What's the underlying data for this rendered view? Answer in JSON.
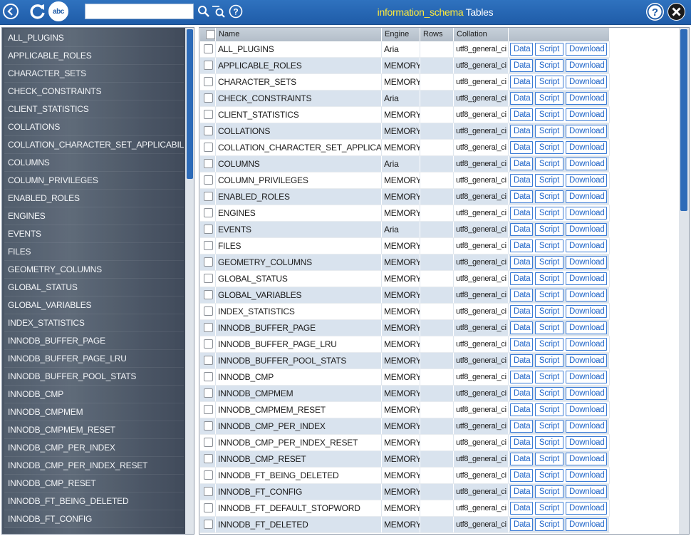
{
  "toolbar": {
    "back_icon": "chevron-left-icon",
    "refresh_icon": "refresh-icon",
    "abc_label": "abc",
    "search_placeholder": "",
    "search_value": ""
  },
  "title": {
    "database": "information_schema",
    "suffix": " Tables"
  },
  "colors": {
    "topbar": "#2a67b4",
    "title_highlight": "#ffeb3b",
    "row_alt": "#d9e3ee",
    "button_text": "#1e64c8"
  },
  "sidebar": {
    "items": [
      "ALL_PLUGINS",
      "APPLICABLE_ROLES",
      "CHARACTER_SETS",
      "CHECK_CONSTRAINTS",
      "CLIENT_STATISTICS",
      "COLLATIONS",
      "COLLATION_CHARACTER_SET_APPLICABILITY",
      "COLUMNS",
      "COLUMN_PRIVILEGES",
      "ENABLED_ROLES",
      "ENGINES",
      "EVENTS",
      "FILES",
      "GEOMETRY_COLUMNS",
      "GLOBAL_STATUS",
      "GLOBAL_VARIABLES",
      "INDEX_STATISTICS",
      "INNODB_BUFFER_PAGE",
      "INNODB_BUFFER_PAGE_LRU",
      "INNODB_BUFFER_POOL_STATS",
      "INNODB_CMP",
      "INNODB_CMPMEM",
      "INNODB_CMPMEM_RESET",
      "INNODB_CMP_PER_INDEX",
      "INNODB_CMP_PER_INDEX_RESET",
      "INNODB_CMP_RESET",
      "INNODB_FT_BEING_DELETED",
      "INNODB_FT_CONFIG"
    ]
  },
  "table": {
    "headers": {
      "name": "Name",
      "engine": "Engine",
      "rows": "Rows",
      "collation": "Collation"
    },
    "buttons": {
      "data": "Data",
      "script": "Script",
      "download": "Download"
    },
    "rows": [
      {
        "name": "ALL_PLUGINS",
        "engine": "Aria",
        "rows": "",
        "collation": "utf8_general_ci"
      },
      {
        "name": "APPLICABLE_ROLES",
        "engine": "MEMORY",
        "rows": "",
        "collation": "utf8_general_ci"
      },
      {
        "name": "CHARACTER_SETS",
        "engine": "MEMORY",
        "rows": "",
        "collation": "utf8_general_ci"
      },
      {
        "name": "CHECK_CONSTRAINTS",
        "engine": "Aria",
        "rows": "",
        "collation": "utf8_general_ci"
      },
      {
        "name": "CLIENT_STATISTICS",
        "engine": "MEMORY",
        "rows": "",
        "collation": "utf8_general_ci"
      },
      {
        "name": "COLLATIONS",
        "engine": "MEMORY",
        "rows": "",
        "collation": "utf8_general_ci"
      },
      {
        "name": "COLLATION_CHARACTER_SET_APPLICABILITY",
        "engine": "MEMORY",
        "rows": "",
        "collation": "utf8_general_ci"
      },
      {
        "name": "COLUMNS",
        "engine": "Aria",
        "rows": "",
        "collation": "utf8_general_ci"
      },
      {
        "name": "COLUMN_PRIVILEGES",
        "engine": "MEMORY",
        "rows": "",
        "collation": "utf8_general_ci"
      },
      {
        "name": "ENABLED_ROLES",
        "engine": "MEMORY",
        "rows": "",
        "collation": "utf8_general_ci"
      },
      {
        "name": "ENGINES",
        "engine": "MEMORY",
        "rows": "",
        "collation": "utf8_general_ci"
      },
      {
        "name": "EVENTS",
        "engine": "Aria",
        "rows": "",
        "collation": "utf8_general_ci"
      },
      {
        "name": "FILES",
        "engine": "MEMORY",
        "rows": "",
        "collation": "utf8_general_ci"
      },
      {
        "name": "GEOMETRY_COLUMNS",
        "engine": "MEMORY",
        "rows": "",
        "collation": "utf8_general_ci"
      },
      {
        "name": "GLOBAL_STATUS",
        "engine": "MEMORY",
        "rows": "",
        "collation": "utf8_general_ci"
      },
      {
        "name": "GLOBAL_VARIABLES",
        "engine": "MEMORY",
        "rows": "",
        "collation": "utf8_general_ci"
      },
      {
        "name": "INDEX_STATISTICS",
        "engine": "MEMORY",
        "rows": "",
        "collation": "utf8_general_ci"
      },
      {
        "name": "INNODB_BUFFER_PAGE",
        "engine": "MEMORY",
        "rows": "",
        "collation": "utf8_general_ci"
      },
      {
        "name": "INNODB_BUFFER_PAGE_LRU",
        "engine": "MEMORY",
        "rows": "",
        "collation": "utf8_general_ci"
      },
      {
        "name": "INNODB_BUFFER_POOL_STATS",
        "engine": "MEMORY",
        "rows": "",
        "collation": "utf8_general_ci"
      },
      {
        "name": "INNODB_CMP",
        "engine": "MEMORY",
        "rows": "",
        "collation": "utf8_general_ci"
      },
      {
        "name": "INNODB_CMPMEM",
        "engine": "MEMORY",
        "rows": "",
        "collation": "utf8_general_ci"
      },
      {
        "name": "INNODB_CMPMEM_RESET",
        "engine": "MEMORY",
        "rows": "",
        "collation": "utf8_general_ci"
      },
      {
        "name": "INNODB_CMP_PER_INDEX",
        "engine": "MEMORY",
        "rows": "",
        "collation": "utf8_general_ci"
      },
      {
        "name": "INNODB_CMP_PER_INDEX_RESET",
        "engine": "MEMORY",
        "rows": "",
        "collation": "utf8_general_ci"
      },
      {
        "name": "INNODB_CMP_RESET",
        "engine": "MEMORY",
        "rows": "",
        "collation": "utf8_general_ci"
      },
      {
        "name": "INNODB_FT_BEING_DELETED",
        "engine": "MEMORY",
        "rows": "",
        "collation": "utf8_general_ci"
      },
      {
        "name": "INNODB_FT_CONFIG",
        "engine": "MEMORY",
        "rows": "",
        "collation": "utf8_general_ci"
      },
      {
        "name": "INNODB_FT_DEFAULT_STOPWORD",
        "engine": "MEMORY",
        "rows": "",
        "collation": "utf8_general_ci"
      },
      {
        "name": "INNODB_FT_DELETED",
        "engine": "MEMORY",
        "rows": "",
        "collation": "utf8_general_ci"
      }
    ]
  }
}
